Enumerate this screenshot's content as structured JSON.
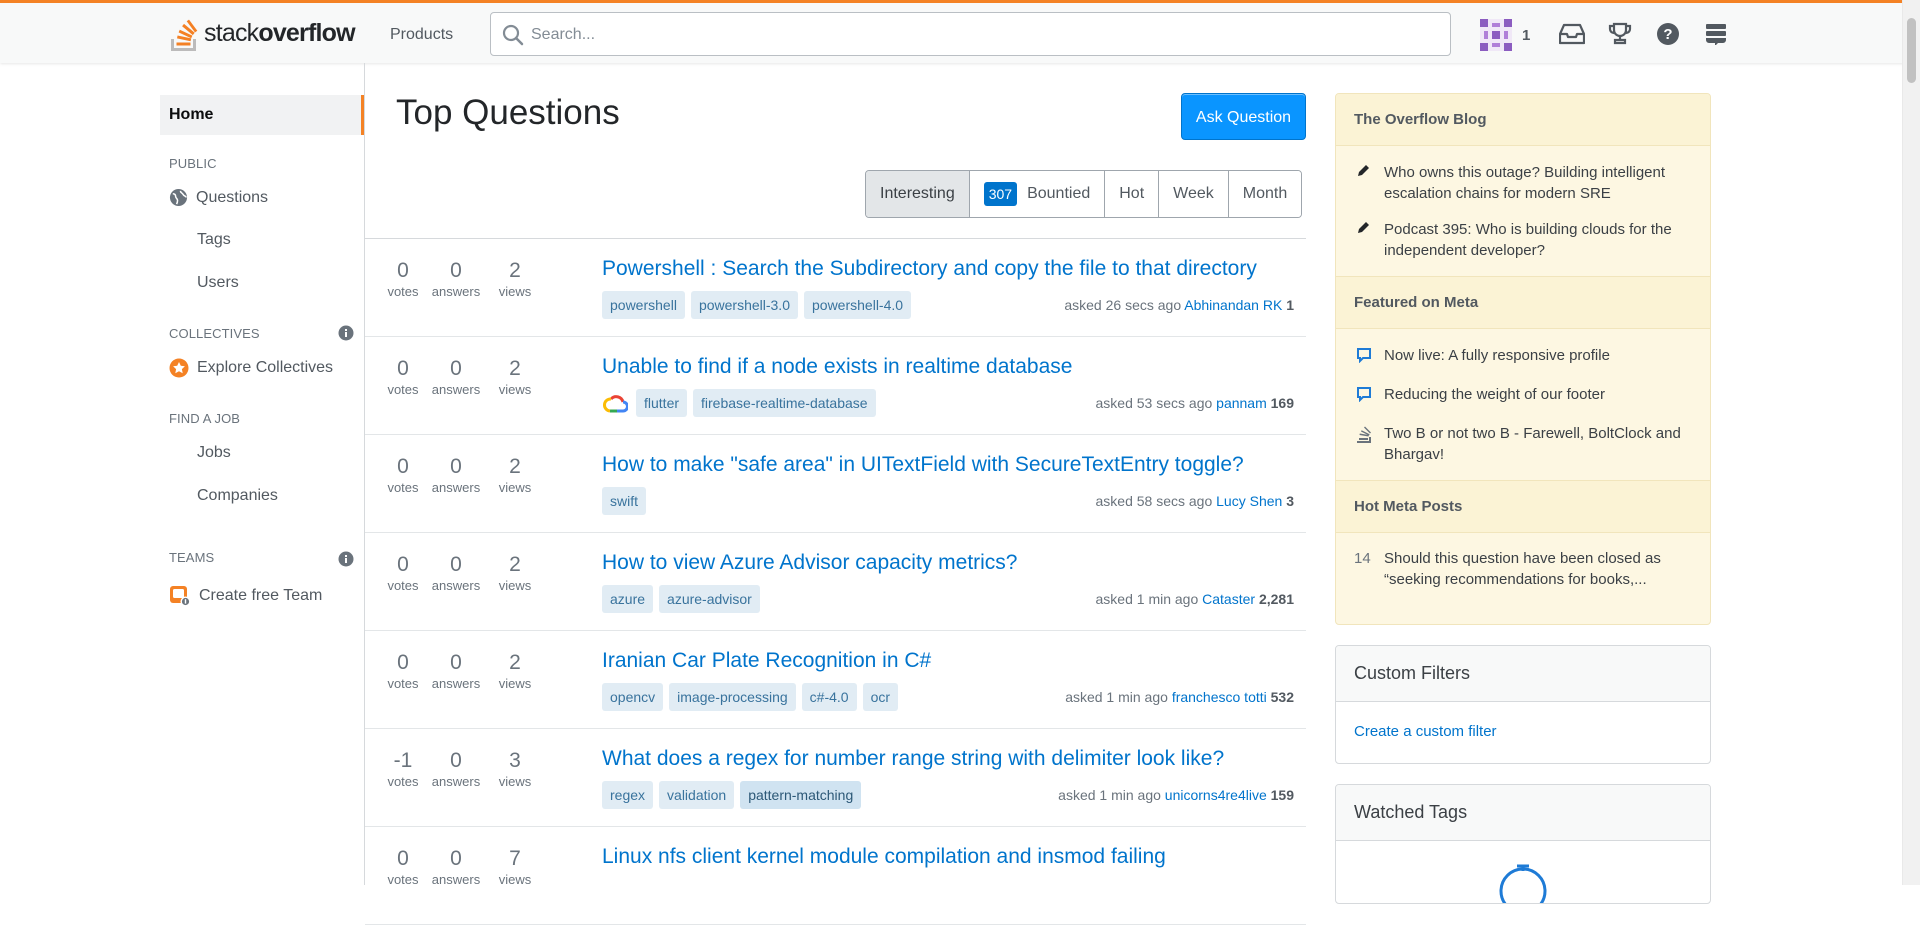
{
  "header": {
    "logo_light": "stack",
    "logo_bold": "overflow",
    "products_label": "Products",
    "search_placeholder": "Search...",
    "reputation": "1"
  },
  "sidebar": {
    "home": "Home",
    "public_label": "PUBLIC",
    "questions": "Questions",
    "tags": "Tags",
    "users": "Users",
    "collectives_label": "COLLECTIVES",
    "explore_collectives": "Explore Collectives",
    "find_job_label": "FIND A JOB",
    "jobs": "Jobs",
    "companies": "Companies",
    "teams_label": "TEAMS",
    "create_team": "Create free Team"
  },
  "main": {
    "title": "Top Questions",
    "ask_button": "Ask Question",
    "filters": {
      "interesting": "Interesting",
      "bounty_count": "307",
      "bountied": "Bountied",
      "hot": "Hot",
      "week": "Week",
      "month": "Month"
    },
    "stat_labels": {
      "votes": "votes",
      "answers": "answers",
      "views": "views"
    },
    "questions": [
      {
        "votes": "0",
        "answers": "0",
        "views": "2",
        "title": "Powershell : Search the Subdirectory and copy the file to that directory",
        "tags": [
          "powershell",
          "powershell-3.0",
          "powershell-4.0"
        ],
        "asked": "asked 26 secs ago",
        "user": "Abhinandan RK",
        "rep": "1"
      },
      {
        "votes": "0",
        "answers": "0",
        "views": "2",
        "title": "Unable to find if a node exists in realtime database",
        "tags": [
          "flutter",
          "firebase-realtime-database"
        ],
        "asked": "asked 53 secs ago",
        "user": "pannam",
        "rep": "169"
      },
      {
        "votes": "0",
        "answers": "0",
        "views": "2",
        "title": "How to make \"safe area\" in UITextField with SecureTextEntry toggle?",
        "tags": [
          "swift"
        ],
        "asked": "asked 58 secs ago",
        "user": "Lucy Shen",
        "rep": "3"
      },
      {
        "votes": "0",
        "answers": "0",
        "views": "2",
        "title": "How to view Azure Advisor capacity metrics?",
        "tags": [
          "azure",
          "azure-advisor"
        ],
        "asked": "asked 1 min ago",
        "user": "Cataster",
        "rep": "2,281"
      },
      {
        "votes": "0",
        "answers": "0",
        "views": "2",
        "title": "Iranian Car Plate Recognition in C#",
        "tags": [
          "opencv",
          "image-processing",
          "c#-4.0",
          "ocr"
        ],
        "asked": "asked 1 min ago",
        "user": "franchesco totti",
        "rep": "532"
      },
      {
        "votes": "-1",
        "answers": "0",
        "views": "3",
        "title": "What does a regex for number range string with delimiter look like?",
        "tags": [
          "regex",
          "validation",
          "pattern-matching"
        ],
        "asked": "asked 1 min ago",
        "user": "unicorns4re4live",
        "rep": "159"
      },
      {
        "votes": "0",
        "answers": "0",
        "views": "7",
        "title": "Linux nfs client kernel module compilation and insmod failing",
        "tags": [],
        "asked": "",
        "user": "",
        "rep": ""
      }
    ]
  },
  "right": {
    "blog_title": "The Overflow Blog",
    "blog_items": [
      "Who owns this outage? Building intelligent escalation chains for modern SRE",
      "Podcast 395: Who is building clouds for the independent developer?"
    ],
    "meta_title": "Featured on Meta",
    "meta_items": [
      "Now live: A fully responsive profile",
      "Reducing the weight of our footer",
      "Two B or not two B - Farewell, BoltClock and Bhargav!"
    ],
    "hot_meta_title": "Hot Meta Posts",
    "hot_meta_count": "14",
    "hot_meta_item": "Should this question have been closed as “seeking recommendations for books,...",
    "custom_filters_title": "Custom Filters",
    "custom_filter_link": "Create a custom filter",
    "watched_tags_title": "Watched Tags"
  },
  "colors": {
    "accent": "#f48225",
    "link": "#0074cc",
    "primary_button": "#0a95ff",
    "blog_bg": "#fdf7e2"
  }
}
